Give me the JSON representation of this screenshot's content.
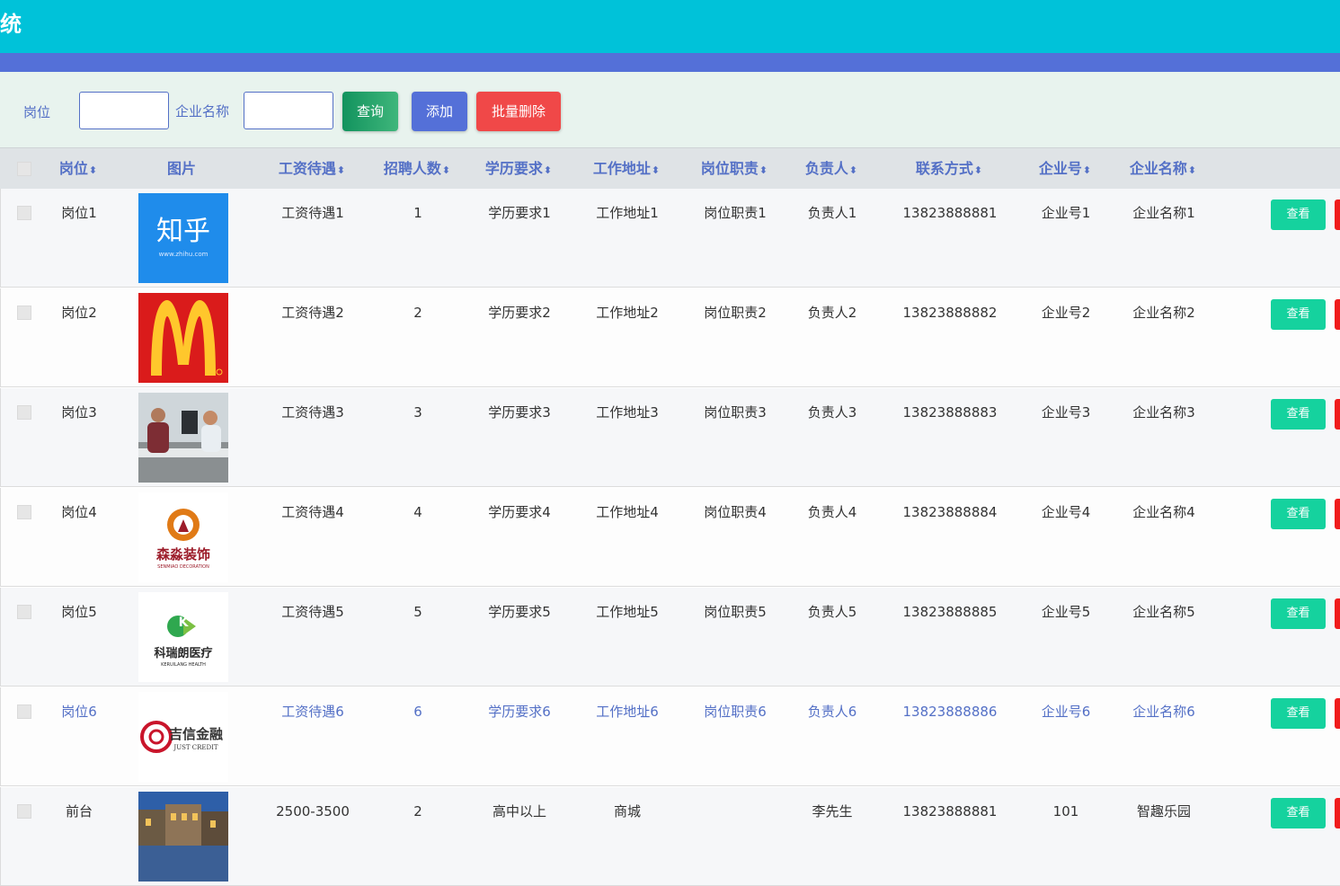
{
  "app": {
    "title": "统"
  },
  "search": {
    "position_label": "岗位",
    "company_label": "企业名称",
    "position_value": "",
    "company_value": "",
    "query_btn": "查询",
    "add_btn": "添加",
    "batch_delete_btn": "批量删除"
  },
  "table": {
    "headers": [
      {
        "label": "岗位",
        "sortable": true
      },
      {
        "label": "图片",
        "sortable": false
      },
      {
        "label": "工资待遇",
        "sortable": true
      },
      {
        "label": "招聘人数",
        "sortable": true
      },
      {
        "label": "学历要求",
        "sortable": true
      },
      {
        "label": "工作地址",
        "sortable": true
      },
      {
        "label": "岗位职责",
        "sortable": true
      },
      {
        "label": "负责人",
        "sortable": true
      },
      {
        "label": "联系方式",
        "sortable": true
      },
      {
        "label": "企业号",
        "sortable": true
      },
      {
        "label": "企业名称",
        "sortable": true
      }
    ],
    "sort_glyph": "⬍",
    "view_btn": "查看",
    "rows": [
      {
        "pos": "岗位1",
        "image": "zhihu-logo",
        "salary": "工资待遇1",
        "count": "1",
        "edu": "学历要求1",
        "addr": "工作地址1",
        "duty": "岗位职责1",
        "owner": "负责人1",
        "phone": "13823888881",
        "bizno": "企业号1",
        "company": "企业名称1"
      },
      {
        "pos": "岗位2",
        "image": "mcdonalds-logo",
        "salary": "工资待遇2",
        "count": "2",
        "edu": "学历要求2",
        "addr": "工作地址2",
        "duty": "岗位职责2",
        "owner": "负责人2",
        "phone": "13823888882",
        "bizno": "企业号2",
        "company": "企业名称2"
      },
      {
        "pos": "岗位3",
        "image": "office-photo",
        "salary": "工资待遇3",
        "count": "3",
        "edu": "学历要求3",
        "addr": "工作地址3",
        "duty": "岗位职责3",
        "owner": "负责人3",
        "phone": "13823888883",
        "bizno": "企业号3",
        "company": "企业名称3"
      },
      {
        "pos": "岗位4",
        "image": "decoration-logo",
        "salary": "工资待遇4",
        "count": "4",
        "edu": "学历要求4",
        "addr": "工作地址4",
        "duty": "岗位职责4",
        "owner": "负责人4",
        "phone": "13823888884",
        "bizno": "企业号4",
        "company": "企业名称4"
      },
      {
        "pos": "岗位5",
        "image": "medical-logo",
        "salary": "工资待遇5",
        "count": "5",
        "edu": "学历要求5",
        "addr": "工作地址5",
        "duty": "岗位职责5",
        "owner": "负责人5",
        "phone": "13823888885",
        "bizno": "企业号5",
        "company": "企业名称5"
      },
      {
        "pos": "岗位6",
        "image": "finance-logo",
        "salary": "工资待遇6",
        "count": "6",
        "edu": "学历要求6",
        "addr": "工作地址6",
        "duty": "岗位职责6",
        "owner": "负责人6",
        "phone": "13823888886",
        "bizno": "企业号6",
        "company": "企业名称6"
      },
      {
        "pos": "前台",
        "image": "city-photo",
        "salary": "2500-3500",
        "count": "2",
        "edu": "高中以上",
        "addr": "商城",
        "duty": "",
        "owner": "李先生",
        "phone": "13823888881",
        "bizno": "101",
        "company": "智趣乐园"
      }
    ]
  },
  "logos": {
    "zhihu_main": "知乎",
    "zhihu_url": "www.zhihu.com",
    "deco_main": "森淼装饰",
    "deco_sub": "SENMIAO DECORATION",
    "medical_main": "科瑞朗医疗",
    "medical_sub": "KERUILANG HEALTH",
    "finance_main": "吉信金融",
    "finance_sub": "JUST CREDIT"
  },
  "colors": {
    "topbar": "#00c2d9",
    "accent": "#5470d8",
    "view_button": "#15d29e",
    "delete_button": "#f04848"
  }
}
